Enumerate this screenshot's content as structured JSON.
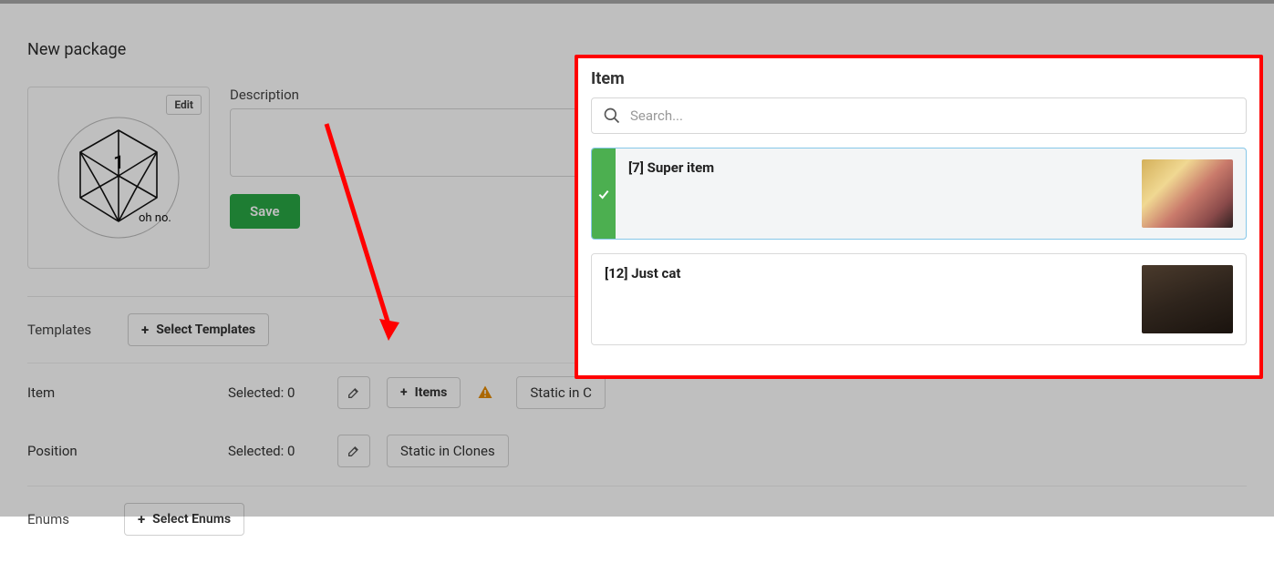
{
  "page": {
    "title": "New package",
    "description_label": "Description",
    "description_value": "",
    "edit_label": "Edit",
    "save_label": "Save"
  },
  "templates": {
    "label": "Templates",
    "select_label": "Select Templates"
  },
  "rows": {
    "item": {
      "label": "Item",
      "selected_text": "Selected: 0",
      "add_label": "Items",
      "static_label": "Static in C"
    },
    "position": {
      "label": "Position",
      "selected_text": "Selected: 0",
      "static_label": "Static in Clones"
    }
  },
  "enums": {
    "label": "Enums",
    "select_label": "Select Enums"
  },
  "popup": {
    "title": "Item",
    "search_placeholder": "Search...",
    "items": [
      {
        "label": "[7] Super item",
        "selected": true
      },
      {
        "label": "[12] Just cat",
        "selected": false
      }
    ]
  }
}
